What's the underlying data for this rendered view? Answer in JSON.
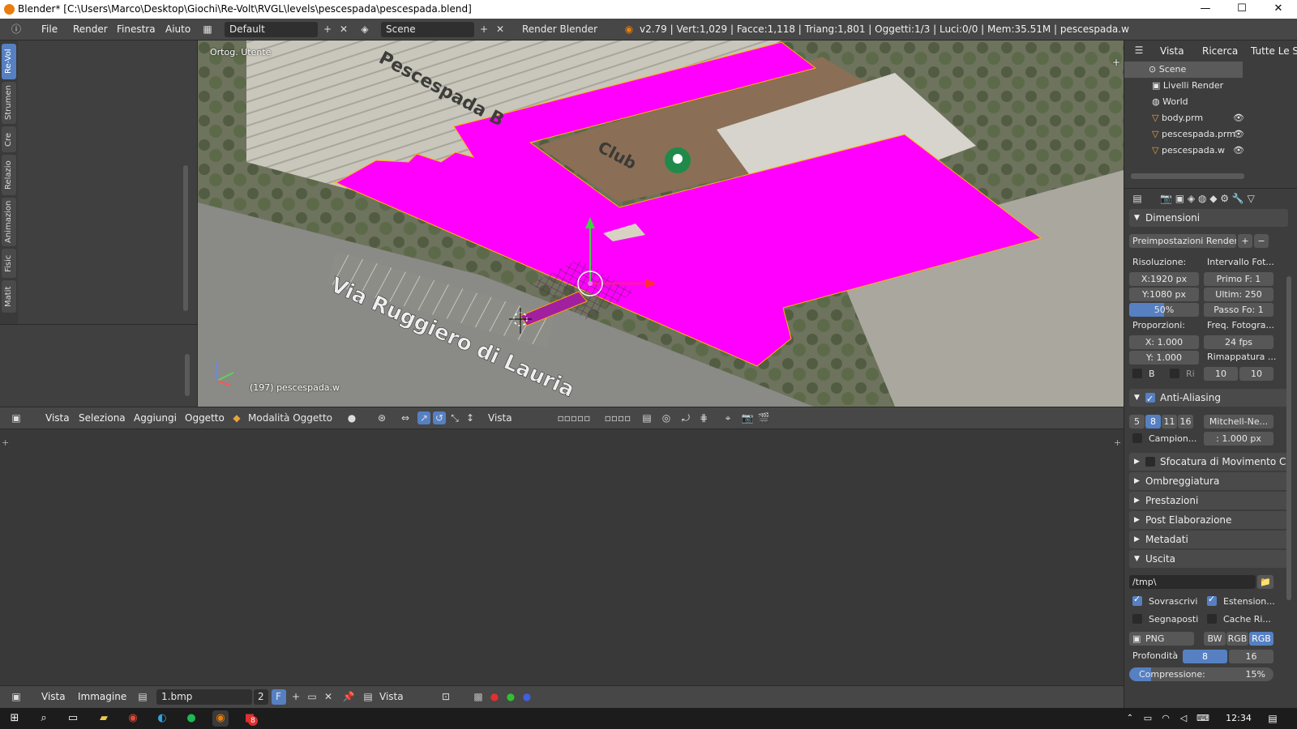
{
  "window": {
    "title": "Blender* [C:\\Users\\Marco\\Desktop\\Giochi\\Re-Volt\\RVGL\\levels\\pescespada\\pescespada.blend]",
    "minimize": "—",
    "maximize": "☐",
    "close": "✕"
  },
  "infobar": {
    "menus": [
      "File",
      "Render",
      "Finestra",
      "Aiuto"
    ],
    "layout": "Default",
    "scene": "Scene",
    "engine": "Render Blender",
    "stats": "v2.79 | Vert:1,029 | Facce:1,118 | Triang:1,801 | Oggetti:1/3 | Luci:0/0 | Mem:35.51M | pescespada.w"
  },
  "left_tabs": [
    "Re-Vol",
    "Strumen",
    "Cre",
    "Relazio",
    "Animazion",
    "Fisic",
    "Matit"
  ],
  "viewport": {
    "view_label": "Ortog. Utente",
    "object_label": "(197) pescespada.w",
    "map_text_top": "Pescespada B",
    "map_text_club": "Club",
    "map_street": "Via Ruggiero di Lauria"
  },
  "view3d_header": {
    "menus": [
      "Vista",
      "Seleziona",
      "Aggiungi",
      "Oggetto"
    ],
    "mode": "Modalità Oggetto",
    "orientation": "Vista"
  },
  "image_header": {
    "menus": [
      "Vista",
      "Immagine"
    ],
    "image_name": "1.bmp",
    "users": "2",
    "fake": "F",
    "view": "Vista"
  },
  "outliner": {
    "tabs": [
      "Vista",
      "Ricerca",
      "Tutte Le Sc"
    ],
    "items": [
      {
        "label": "Scene",
        "level": 0
      },
      {
        "label": "Livelli Render",
        "level": 1
      },
      {
        "label": "World",
        "level": 1
      },
      {
        "label": "body.prm",
        "level": 1
      },
      {
        "label": "pescespada.prm",
        "level": 1
      },
      {
        "label": "pescespada.w",
        "level": 1
      }
    ]
  },
  "properties": {
    "dimensioni": "Dimensioni",
    "preset": "Preimpostazioni Render",
    "risoluzione": "Risoluzione:",
    "res_x": "X:1920 px",
    "res_y": "Y:1080 px",
    "res_pct": "50%",
    "res_pct_value": 0.5,
    "intervallo": "Intervallo Fot...",
    "primo": "Primo F:  1",
    "ultimo": "Ultim: 250",
    "passo": "Passo Fo: 1",
    "proporzioni": "Proporzioni:",
    "asp_x": "X:   1.000",
    "asp_y": "Y:   1.000",
    "freq": "Freq. Fotogra...",
    "fps": "24 fps",
    "rimappatura": "Rimappatura ...",
    "remap_a": "10",
    "remap_b": "10",
    "b": "B",
    "ri": "Ri",
    "antialiasing": "Anti-Aliasing",
    "aa_samples": [
      "5",
      "8",
      "11",
      "16"
    ],
    "aa_filter": "Mitchell-Ne...",
    "campion": "Campion...",
    "filter_size": ": 1.000 px",
    "sfocatura": "Sfocatura di Movimento Ca",
    "ombreggiatura": "Ombreggiatura",
    "prestazioni": "Prestazioni",
    "post": "Post Elaborazione",
    "metadati": "Metadati",
    "uscita": "Uscita",
    "path": "/tmp\\",
    "sovrascrivi": "Sovrascrivi",
    "estensioni": "Estension...",
    "segnaposti": "Segnaposti",
    "cache": "Cache Ri...",
    "format": "PNG",
    "bw": "BW",
    "rgb": "RGB",
    "rgba": "RGB",
    "profondita": "Profondità",
    "depth8": "8",
    "depth16": "16",
    "compressione": "Compressione:",
    "compression_pct": "15%",
    "compression_value": 0.15
  },
  "taskbar": {
    "time": "12:34",
    "badge": "8"
  },
  "colors": {
    "magenta": "#ff00ff",
    "accent": "#5680c2"
  }
}
